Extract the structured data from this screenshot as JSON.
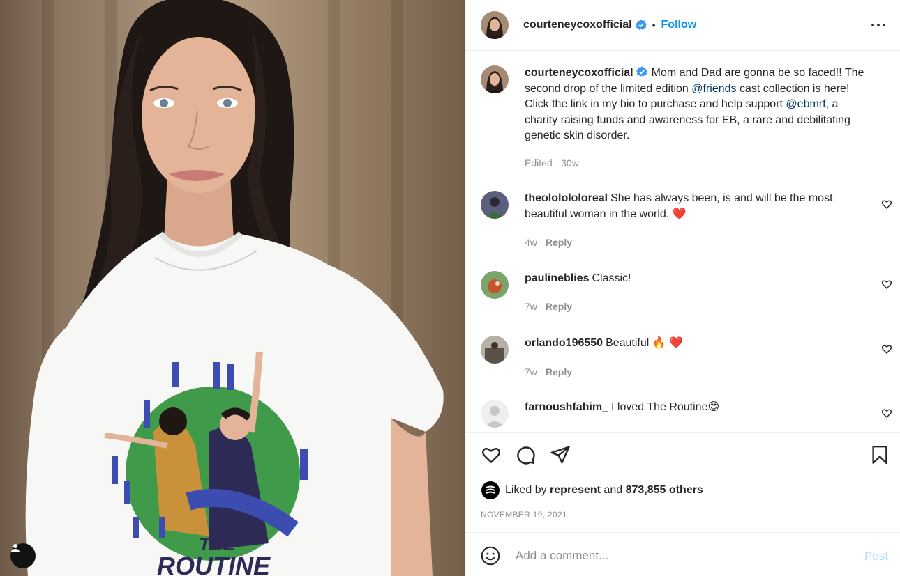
{
  "photo": {
    "shirt_text_line1": "THE",
    "shirt_text_line2": "ROUTINE",
    "user_tag_icon": "user-tag-icon"
  },
  "header": {
    "username": "courteneycoxofficial",
    "separator": "•",
    "follow_label": "Follow",
    "more_icon": "more-options-icon"
  },
  "caption": {
    "username": "courteneycoxofficial",
    "text_part1": "Mom and Dad are gonna be so faced!! The second drop of the limited edition ",
    "mention1": "@friends",
    "text_part2": " cast collection is here! Click the link in my bio to purchase and help support ",
    "mention2": "@ebmrf",
    "text_part3": ", a charity raising funds and awareness for EB, a rare and debilitating genetic skin disorder.",
    "meta": "Edited · 30w"
  },
  "comments": [
    {
      "username": "theololololoreal",
      "text": "She has always been, is and will be the most beautiful woman in the world. ",
      "emoji": "❤️",
      "time": "4w",
      "reply": "Reply"
    },
    {
      "username": "paulineblies",
      "text": "Classic!",
      "emoji": "",
      "time": "7w",
      "reply": "Reply"
    },
    {
      "username": "orlando196550",
      "text": "Beautiful ",
      "emoji": "🔥 ❤️",
      "time": "7w",
      "reply": "Reply"
    },
    {
      "username": "farnoushfahim_",
      "text": "I loved The Routine",
      "emoji": "😍",
      "time": "",
      "reply": ""
    }
  ],
  "actions": {
    "like_icon": "heart-icon",
    "comment_icon": "comment-icon",
    "share_icon": "share-icon",
    "save_icon": "bookmark-icon"
  },
  "likes": {
    "prefix": "Liked by ",
    "liker": "represent",
    "middle": " and ",
    "count": "873,855 others"
  },
  "date": "NOVEMBER 19, 2021",
  "comment_box": {
    "placeholder": "Add a comment...",
    "post_label": "Post"
  },
  "colors": {
    "accent": "#0095f6",
    "verified": "#3897f0",
    "mention": "#00376b",
    "muted": "#8e8e8e",
    "post_disabled": "#b2dffc",
    "heart_red": "#ed4956"
  }
}
